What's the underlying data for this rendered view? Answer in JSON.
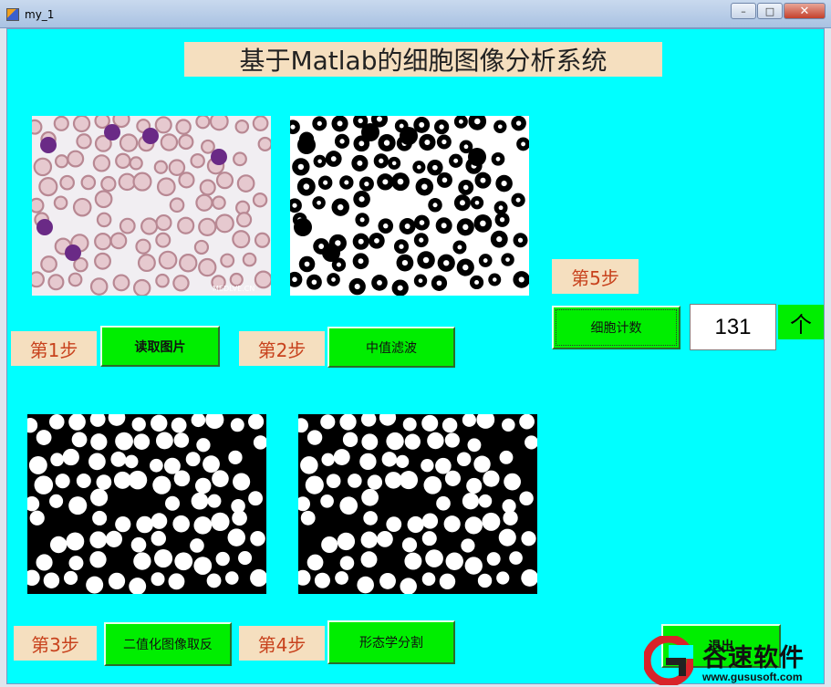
{
  "window": {
    "title": "my_1",
    "minimize": "–",
    "maximize": "□",
    "close": "✕"
  },
  "app": {
    "title": "基于Matlab的细胞图像分析系统"
  },
  "images": {
    "original_watermark": "MEDLVE.CN"
  },
  "steps": {
    "step1": "第1步",
    "step2": "第2步",
    "step3": "第3步",
    "step4": "第4步",
    "step5": "第5步"
  },
  "buttons": {
    "read_image": "读取图片",
    "median_filter": "中值滤波",
    "binarize_invert": "二值化图像取反",
    "morphology_segment": "形态学分割",
    "count_cells": "细胞计数",
    "exit": "退出"
  },
  "result": {
    "count": "131",
    "unit": "个"
  },
  "watermark": {
    "name": "谷速软件",
    "url": "www.gususoft.com"
  },
  "colors": {
    "background": "#00ffff",
    "button": "#00ee00",
    "label_bg": "#f5dfbf",
    "step_text": "#c8421d"
  }
}
